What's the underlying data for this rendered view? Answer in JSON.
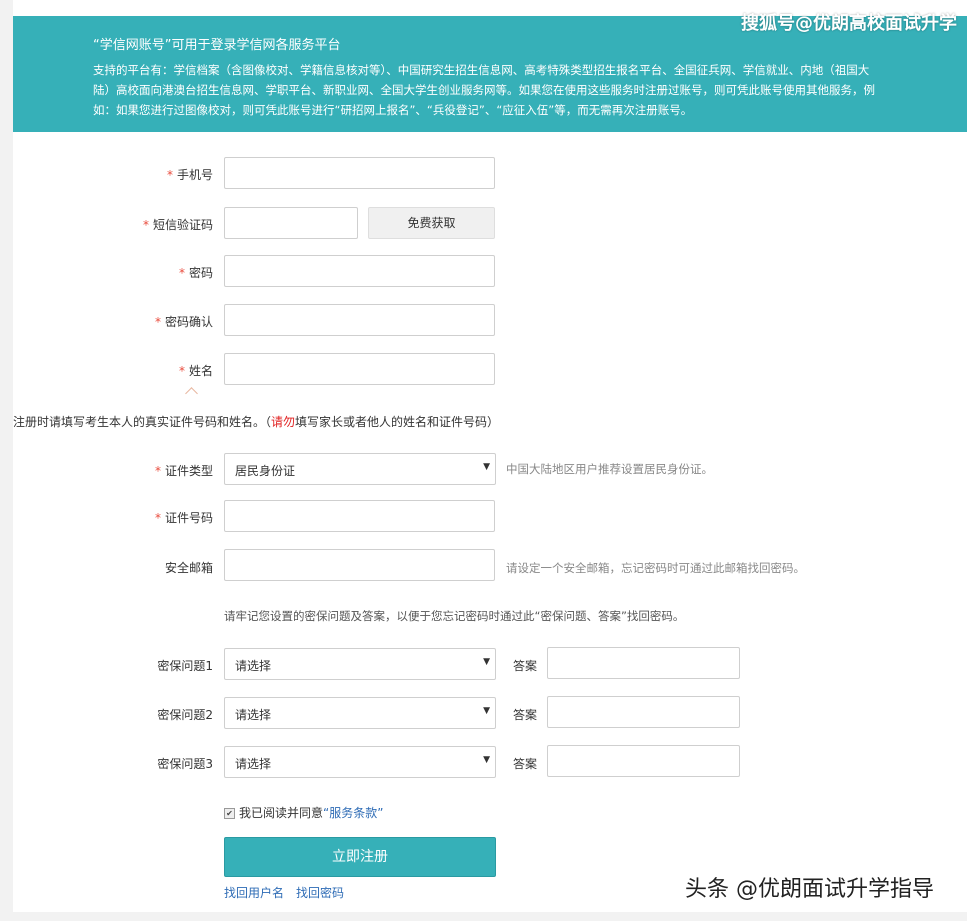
{
  "banner": {
    "title": "“学信网账号”可用于登录学信网各服务平台",
    "description": "支持的平台有：学信档案（含图像校对、学籍信息核对等）、中国研究生招生信息网、高考特殊类型招生报名平台、全国征兵网、学信就业、内地（祖国大陆）高校面向港澳台招生信息网、学职平台、新职业网、全国大学生创业服务网等。如果您在使用这些服务时注册过账号，则可凭此账号使用其他服务，例如：如果您进行过图像校对，则可凭此账号进行“研招网上报名”、“兵役登记”、“应征入伍”等，而无需再次注册账号。"
  },
  "watermarks": {
    "top": "搜狐号@优朗高校面试升学",
    "bottom": "头条 @优朗面试升学指导"
  },
  "form": {
    "required_mark": "*",
    "phone_label": "手机号",
    "sms_code_label": "短信验证码",
    "sms_button": "免费获取",
    "password_label": "密码",
    "password_confirm_label": "密码确认",
    "name_label": "姓名",
    "notice_before": "注册时请填写考生本人的真实证件号码和姓名。（",
    "notice_red": "请勿",
    "notice_after": "填写家长或者他人的姓名和证件号码）",
    "id_type_label": "证件类型",
    "id_type_value": "居民身份证",
    "id_type_hint": "中国大陆地区用户推荐设置居民身份证。",
    "id_number_label": "证件号码",
    "email_label": "安全邮箱",
    "email_hint": "请设定一个安全邮箱，忘记密码时可通过此邮箱找回密码。",
    "security_notice": "请牢记您设置的密保问题及答案，以便于您忘记密码时通过此“密保问题、答案”找回密码。",
    "questions": [
      {
        "label": "密保问题1",
        "value": "请选择",
        "answer_label": "答案"
      },
      {
        "label": "密保问题2",
        "value": "请选择",
        "answer_label": "答案"
      },
      {
        "label": "密保问题3",
        "value": "请选择",
        "answer_label": "答案"
      }
    ],
    "agree_text": "我已阅读并同意",
    "agree_link": "“服务条款”",
    "register_button": "立即注册",
    "find_username": "找回用户名",
    "find_password": "找回密码"
  },
  "colors": {
    "accent": "#36b0b8",
    "required": "#e94b3c",
    "link": "#2d6bb5"
  }
}
